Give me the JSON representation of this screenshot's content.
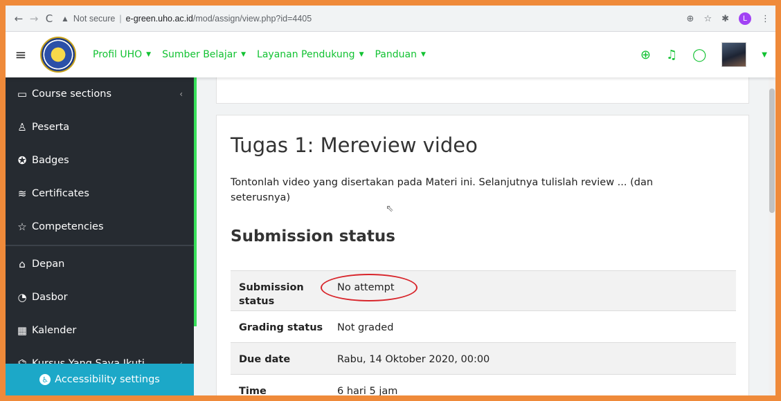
{
  "browser": {
    "back": "←",
    "forward": "→",
    "reload": "C",
    "security": "Not secure",
    "url_host": "e-green.uho.ac.id",
    "url_path": "/mod/assign/view.php?id=4405",
    "profile_initial": "L"
  },
  "navbar": {
    "menu": [
      {
        "label": "Profil UHO"
      },
      {
        "label": "Sumber Belajar"
      },
      {
        "label": "Layanan Pendukung"
      },
      {
        "label": "Panduan"
      }
    ],
    "accent": "#12c232"
  },
  "sidebar": {
    "items": [
      {
        "label": "Course sections",
        "icon": "folder-icon"
      },
      {
        "label": "Peserta",
        "icon": "users-icon"
      },
      {
        "label": "Badges",
        "icon": "badge-icon"
      },
      {
        "label": "Certificates",
        "icon": "certificate-icon"
      },
      {
        "label": "Competencies",
        "icon": "star-icon"
      },
      {
        "label": "Depan",
        "icon": "home-icon"
      },
      {
        "label": "Dasbor",
        "icon": "dashboard-icon"
      },
      {
        "label": "Kalender",
        "icon": "calendar-icon"
      },
      {
        "label": "Kursus Yang Saya Ikuti",
        "icon": "graduation-cap-icon"
      }
    ],
    "accessibility": "Accessibility settings"
  },
  "main": {
    "title": "Tugas 1: Mereview video",
    "description": "Tontonlah video yang disertakan pada Materi ini. Selanjutnya tulislah review ... (dan seterusnya)",
    "status_heading": "Submission status",
    "rows": [
      {
        "label": "Submission status",
        "value": "No attempt"
      },
      {
        "label": "Grading status",
        "value": "Not graded"
      },
      {
        "label": "Due date",
        "value": "Rabu, 14 Oktober 2020, 00:00"
      },
      {
        "label": "Time remaining",
        "value": "6 hari 5 jam"
      }
    ]
  }
}
